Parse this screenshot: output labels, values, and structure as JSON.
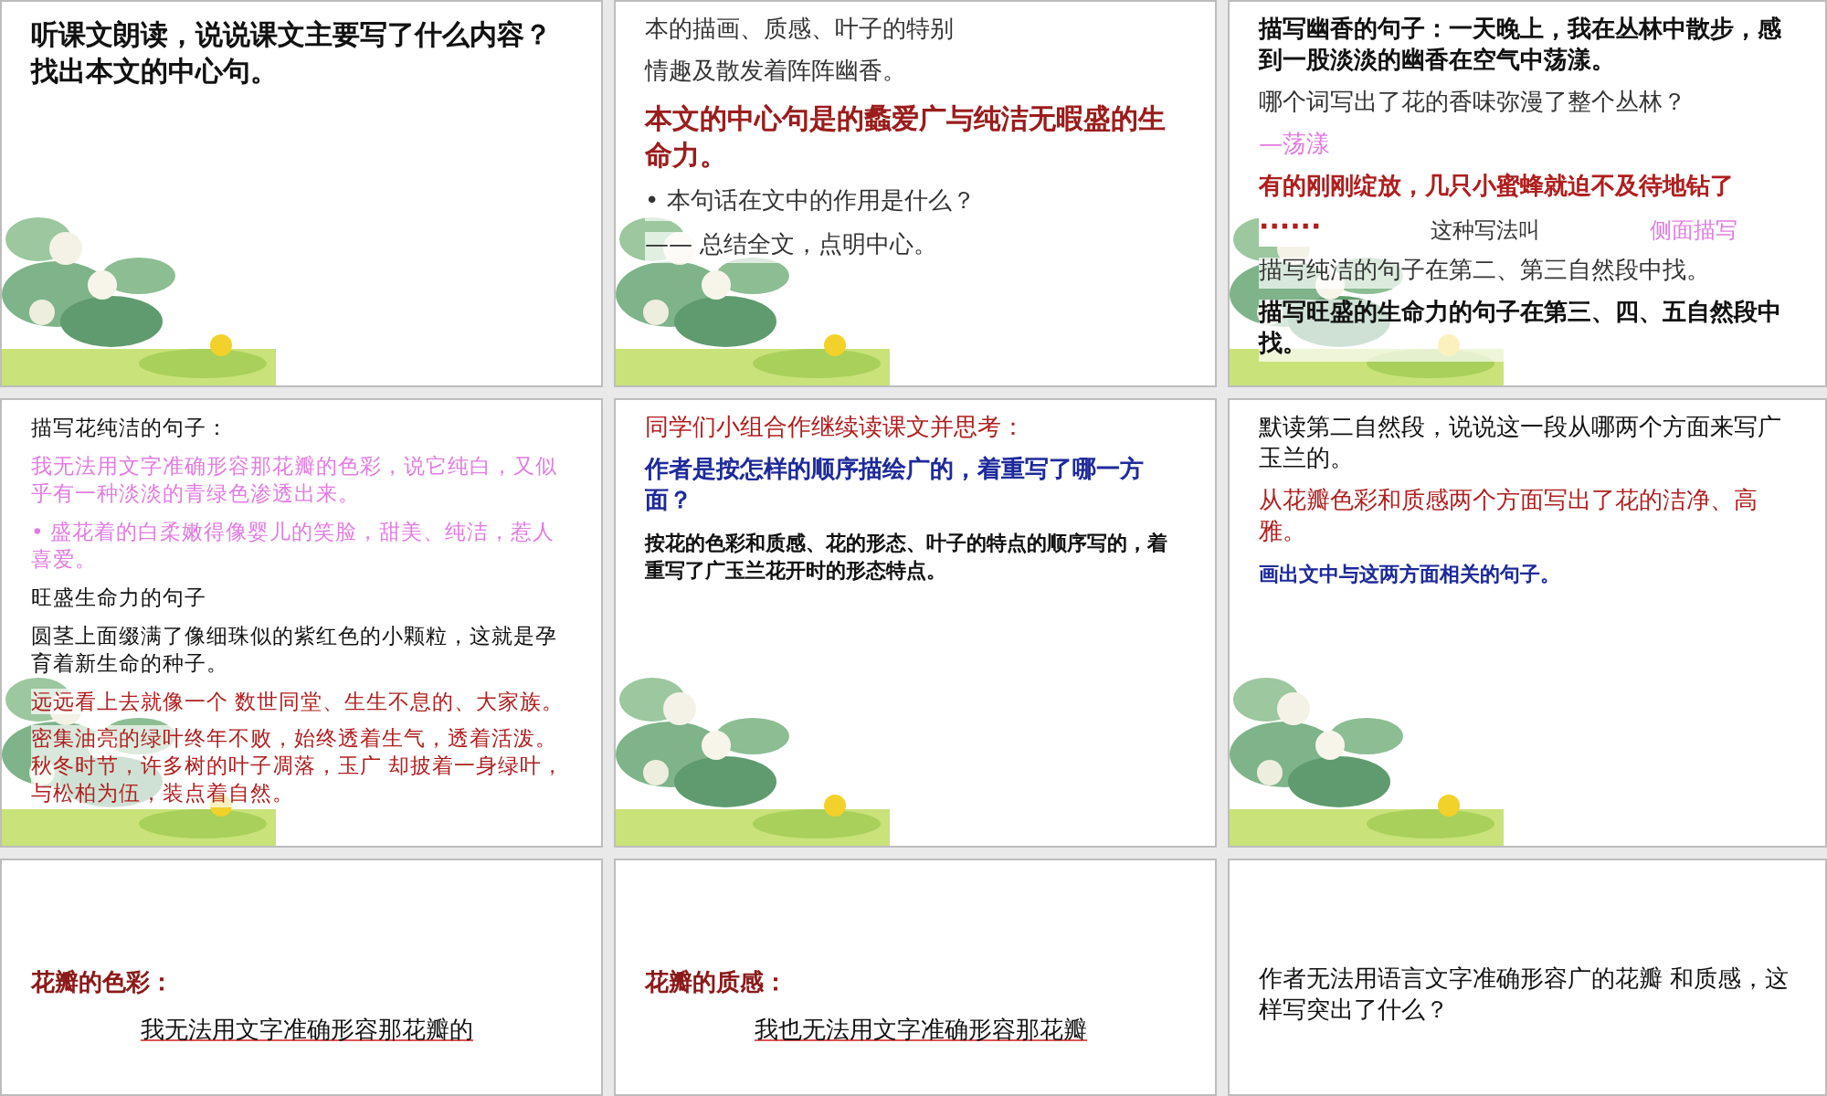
{
  "slides": [
    {
      "picture": true,
      "lines": [
        {
          "kind": "title",
          "color": "#111111",
          "text": "听课文朗读，说说课文主要写了什么内容？找出本文的中心句。"
        }
      ]
    },
    {
      "picture": true,
      "lines": [
        {
          "kind": "body",
          "color": "#333333",
          "text": "本的描画、质感、叶子的特别"
        },
        {
          "kind": "body",
          "color": "#333333",
          "text": "情趣及散发着阵阵幽香。"
        },
        {
          "kind": "title",
          "color": "#9b1c1c",
          "text": "本文的中心句是的蠡爱广与纯洁无暇盛的生命力。"
        },
        {
          "kind": "bullet",
          "color": "#333333",
          "text": "• 本句话在文中的作用是什么？"
        },
        {
          "kind": "body",
          "color": "#333333",
          "text": "—— 总结全文，点明中心。"
        }
      ]
    },
    {
      "picture": true,
      "lines": [
        {
          "kind": "bold",
          "color": "#111111",
          "text": "描写幽香的句子：一天晚上，我在丛林中散步，感到一股淡淡的幽香在空气中荡漾。"
        },
        {
          "kind": "body",
          "color": "#333333",
          "text": "哪个词写出了花的香味弥漫了整个丛林？"
        },
        {
          "kind": "body",
          "color": "#e27be2",
          "text": "—荡漾"
        },
        {
          "kind": "bold",
          "color": "#b01e1e",
          "text": "有的刚刚绽放，几只小蜜蜂就迫不及待地钻了"
        },
        {
          "kind": "split",
          "parts": [
            {
              "text": "······",
              "color": "#b01e1e"
            },
            {
              "text": "这种写法叫",
              "color": "#333333"
            },
            {
              "text": "侧面描写",
              "color": "#e27be2"
            }
          ]
        },
        {
          "kind": "body",
          "color": "#333333",
          "text": "描写纯洁的句子在第二、第三自然段中找。"
        },
        {
          "kind": "bold",
          "color": "#111111",
          "text": "描写旺盛的生命力的句子在第三、四、五自然段中找。"
        }
      ]
    },
    {
      "picture": true,
      "lines": [
        {
          "kind": "small",
          "color": "#111111",
          "text": "描写花纯洁的句子："
        },
        {
          "kind": "small",
          "color": "#e27be2",
          "text": "我无法用文字准确形容那花瓣的色彩，说它纯白，又似乎有一种淡淡的青绿色渗透出来。"
        },
        {
          "kind": "small",
          "color": "#e27be2",
          "text": "• 盛花着的白柔嫩得像婴儿的笑脸，甜美、纯洁，惹人喜爱。"
        },
        {
          "kind": "small",
          "color": "#111111",
          "text": "旺盛生命力的句子"
        },
        {
          "kind": "small",
          "color": "#111111",
          "text": "圆茎上面缀满了像细珠似的紫红色的小颗粒，这就是孕育着新生命的种子。"
        },
        {
          "kind": "small",
          "color": "#b01e1e",
          "text": "远远看上去就像一个 数世同堂、生生不息的、大家族。"
        },
        {
          "kind": "small",
          "color": "#b01e1e",
          "text": "密集油亮的绿叶终年不败，始终透着生气，透着活泼。秋冬时节，许多树的叶子凋落，玉广 却披着一身绿叶，与松柏为伍，装点着自然。"
        }
      ]
    },
    {
      "picture": true,
      "lines": [
        {
          "kind": "body",
          "color": "#b01e1e",
          "text": "同学们小组合作继续读课文并思考："
        },
        {
          "kind": "bold",
          "color": "#1e2a9b",
          "text": "作者是按怎样的顺序描绘广的，着重写了哪一方面？"
        },
        {
          "kind": "note",
          "color": "#111111",
          "text": "按花的色彩和质感、花的形态、叶子的特点的顺序写的，着重写了广玉兰花开时的形态特点。"
        }
      ]
    },
    {
      "picture": true,
      "lines": [
        {
          "kind": "body",
          "color": "#111111",
          "text": "默读第二自然段，说说这一段从哪两个方面来写广玉兰的。"
        },
        {
          "kind": "body",
          "color": "#b01e1e",
          "text": "从花瓣色彩和质感两个方面写出了花的洁净、高雅。"
        },
        {
          "kind": "note",
          "color": "#1e2a9b",
          "text": "画出文中与这两方面相关的句子。"
        }
      ]
    },
    {
      "picture": false,
      "lines": [
        {
          "kind": "heading",
          "color": "#8b1a1a",
          "text": "花瓣的色彩："
        },
        {
          "kind": "under",
          "color": "#111111",
          "text": "我无法用文字准确形容那花瓣的"
        }
      ]
    },
    {
      "picture": false,
      "lines": [
        {
          "kind": "heading",
          "color": "#8b1a1a",
          "text": "花瓣的质感："
        },
        {
          "kind": "under",
          "color": "#111111",
          "text": "我也无法用文字准确形容那花瓣"
        }
      ]
    },
    {
      "picture": false,
      "lines": [
        {
          "kind": "body",
          "color": "#111111",
          "text": "作者无法用语言文字准确形容广的花瓣 和质感，这样写突出了什么？"
        }
      ]
    }
  ]
}
